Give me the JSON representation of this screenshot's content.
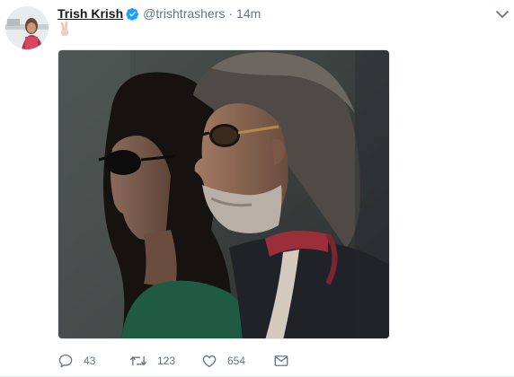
{
  "tweet": {
    "display_name": "Trish Krish",
    "screen_name": "@trishtrashers",
    "separator": "·",
    "timestamp": "14m",
    "text_emoji": "victory-hand-emoji",
    "verified": true,
    "counts": {
      "replies": "43",
      "retweets": "123",
      "likes": "654"
    }
  },
  "icons": {
    "verified": "verified-badge-icon",
    "caret": "chevron-down-icon",
    "reply": "reply-icon",
    "retweet": "retweet-icon",
    "like": "heart-icon",
    "dm": "envelope-icon"
  },
  "colors": {
    "verified_blue": "#1da1f2",
    "secondary_text": "#657786",
    "primary_text": "#14171a"
  }
}
